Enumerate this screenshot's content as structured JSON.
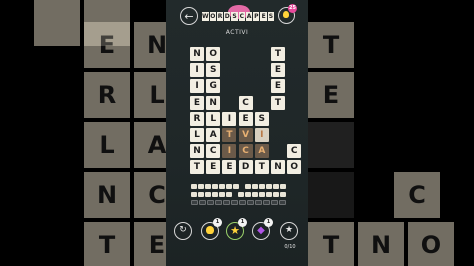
{
  "header": {
    "logo_letters": [
      "W",
      "O",
      "R",
      "D",
      "S",
      "C",
      "A",
      "P",
      "E",
      "S"
    ],
    "back_icon": "arrow-left-icon",
    "hint_icon": "lightbulb-icon",
    "hint_badge": "25",
    "level_name": "ACTIVI"
  },
  "board": {
    "rows": [
      [
        "N",
        "O",
        "",
        "",
        "",
        "T"
      ],
      [
        "I",
        "S",
        "",
        "",
        "",
        "E"
      ],
      [
        "I",
        "G",
        "",
        "",
        "",
        "E"
      ],
      [
        "E",
        "N",
        "",
        "C",
        "",
        "T"
      ],
      [
        "R",
        "L",
        "I",
        "E",
        "S",
        ""
      ],
      [
        "L",
        "A",
        "T",
        "V",
        "I",
        ""
      ],
      [
        "N",
        "C",
        "I",
        "C",
        "A",
        ""
      ],
      [
        "T",
        "E",
        "E",
        "D",
        "T",
        "N",
        "O"
      ]
    ],
    "extra_right_letter": "C",
    "highlight_letters": [
      "T",
      "V",
      "I",
      "C",
      "A"
    ]
  },
  "backdrop": {
    "left_letters": [
      "E",
      "N",
      "R",
      "L",
      "L",
      "A",
      "N",
      "C",
      "T",
      "E"
    ],
    "right_letters": [
      "T",
      "E",
      "C",
      "C",
      "T",
      "N",
      "O"
    ]
  },
  "toolbar": {
    "shuffle_icon": "shuffle-icon",
    "hint_icon": "lightbulb-icon",
    "hint_count": "1",
    "star_icon": "star-icon",
    "star_count": "1",
    "gem_icon": "gem-icon",
    "gem_count": "1",
    "bonus_icon": "bonus-star-icon",
    "progress": "0/10"
  },
  "colors": {
    "tile": "#f2eee2",
    "highlight_tile": "#6b5a49",
    "highlight_text": "#e8b072",
    "panel": "#222a2b",
    "badge": "#e8489b"
  }
}
